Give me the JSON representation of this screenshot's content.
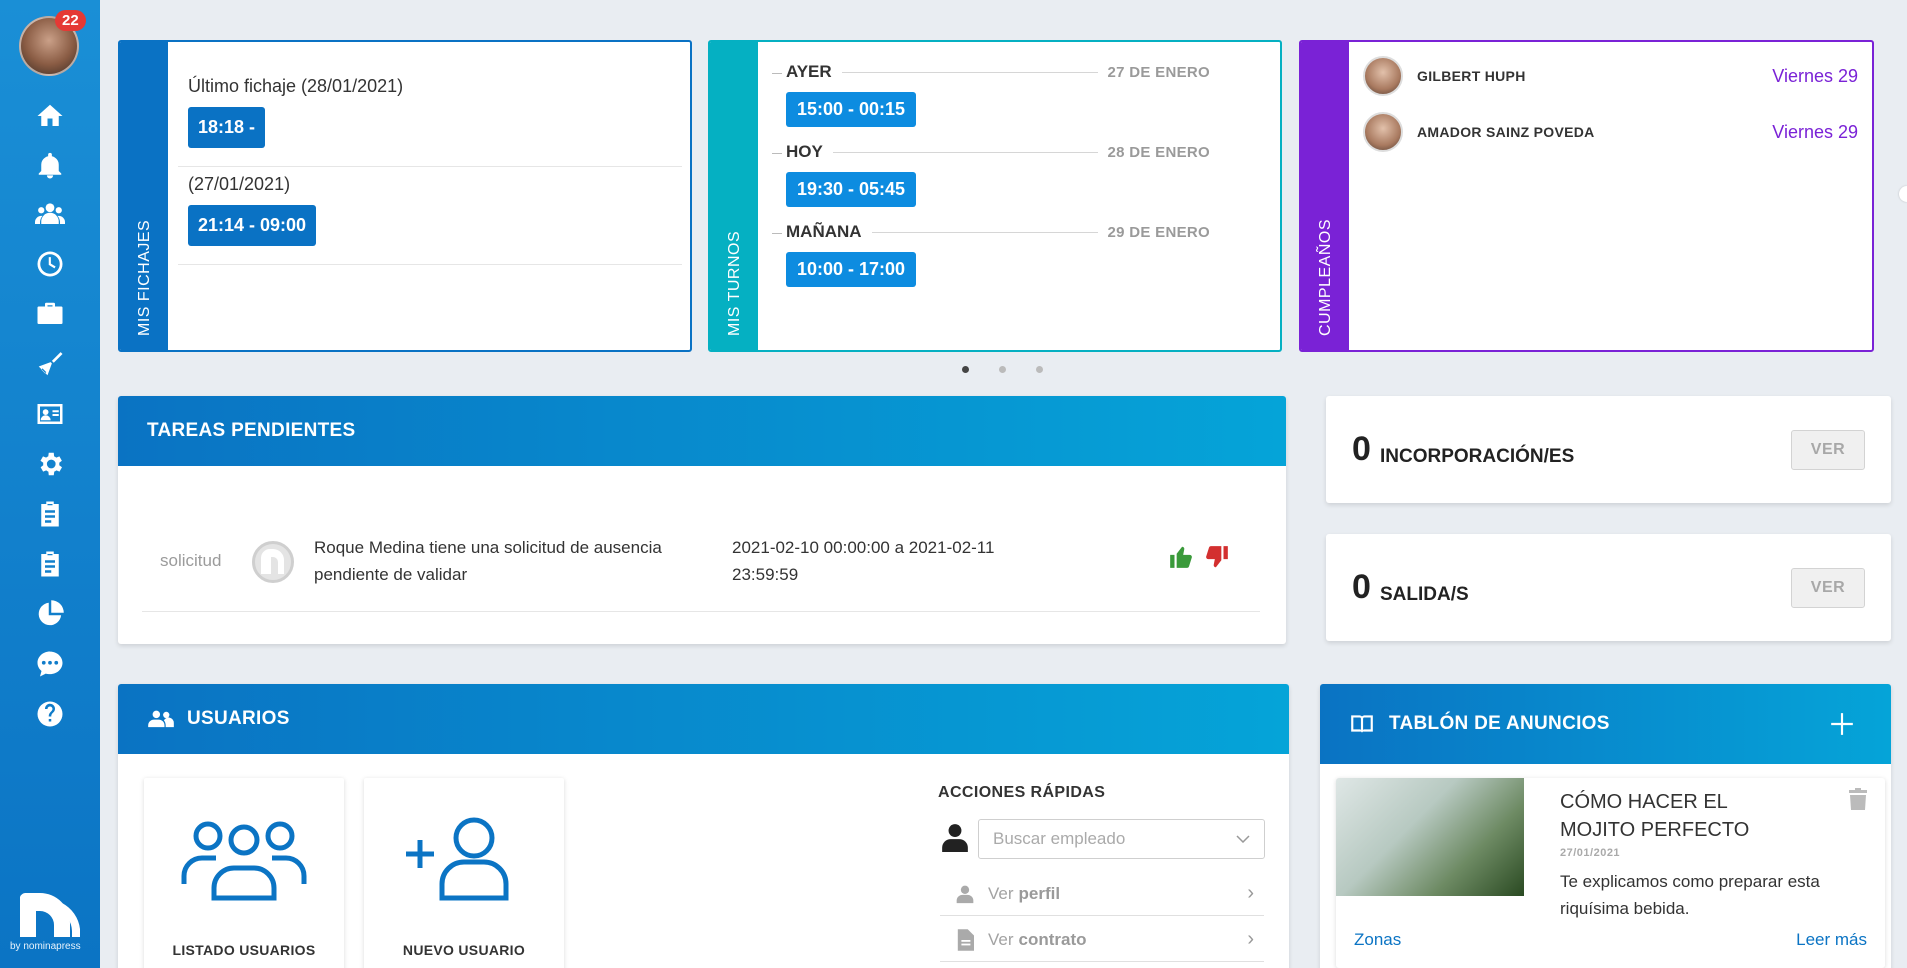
{
  "sidebar": {
    "notification_count": "22",
    "icons": [
      "home-icon",
      "bell-icon",
      "users-icon",
      "clock-icon",
      "briefcase-icon",
      "broom-icon",
      "id-card-icon",
      "gear-icon",
      "clipboard-icon",
      "clipboard-check-icon",
      "pie-chart-icon",
      "chat-icon",
      "help-icon"
    ],
    "brand_by": "by nominapress"
  },
  "fichajes": {
    "tab_label": "MIS FICHAJES",
    "entries": [
      {
        "label": "Último fichaje (28/01/2021)",
        "time": "18:18 -"
      },
      {
        "label": "(27/01/2021)",
        "time": "21:14 - 09:00"
      }
    ],
    "accent": "#0a72c4"
  },
  "turnos": {
    "tab_label": "MIS TURNOS",
    "items": [
      {
        "day": "AYER",
        "date": "27 DE ENERO",
        "time": "15:00 - 00:15"
      },
      {
        "day": "HOY",
        "date": "28 DE ENERO",
        "time": "19:30 - 05:45"
      },
      {
        "day": "MAÑANA",
        "date": "29 DE ENERO",
        "time": "10:00 - 17:00"
      }
    ],
    "accent": "#05b0c2"
  },
  "cumpleanos": {
    "tab_label": "CUMPLEAÑOS",
    "people": [
      {
        "name": "GILBERT HUPH",
        "date": "Viernes 29"
      },
      {
        "name": "AMADOR SAINZ POVEDA",
        "date": "Viernes 29"
      }
    ],
    "accent": "#7a22d6"
  },
  "tareas": {
    "title": "TAREAS PENDIENTES",
    "rows": [
      {
        "type": "solicitud",
        "text": "Roque Medina tiene una solicitud de ausencia pendiente de validar",
        "date": "2021-02-10 00:00:00 a 2021-02-11 23:59:59"
      }
    ]
  },
  "incorporaciones": {
    "count": "0",
    "label": "INCORPORACIÓN/ES",
    "button": "VER"
  },
  "salidas": {
    "count": "0",
    "label": "SALIDA/S",
    "button": "VER"
  },
  "usuarios": {
    "title": "USUARIOS",
    "tiles": [
      {
        "label": "LISTADO USUARIOS"
      },
      {
        "label": "NUEVO USUARIO"
      }
    ],
    "quick_actions": {
      "title": "ACCIONES RÁPIDAS",
      "search_placeholder": "Buscar empleado",
      "items": [
        {
          "prefix": "Ver",
          "bold": "perfil"
        },
        {
          "prefix": "Ver",
          "bold": "contrato"
        }
      ]
    }
  },
  "anuncios": {
    "title": "TABLÓN DE ANUNCIOS",
    "post": {
      "title": "CÓMO HACER EL MOJITO PERFECTO",
      "date": "27/01/2021",
      "description": "Te explicamos como preparar esta riquísima bebida.",
      "zone_link": "Zonas",
      "more_link": "Leer más"
    }
  }
}
